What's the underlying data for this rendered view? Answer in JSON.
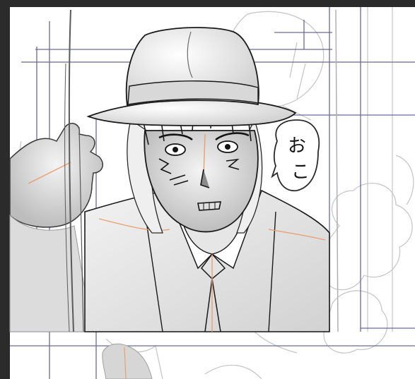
{
  "app": {
    "canvas_background": "#2b2b2b",
    "paper_color": "#ffffff"
  },
  "artwork": {
    "speech_bubble_text": [
      "お",
      "こ"
    ],
    "guide_line_color": "#6a6a96",
    "sketch_line_color": "#bfbfbf",
    "ink_color": "#141414",
    "accent_line_color": "#e8a070"
  }
}
